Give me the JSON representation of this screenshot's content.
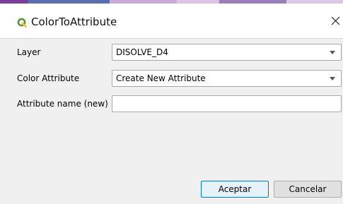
{
  "window": {
    "title": "ColorToAttribute",
    "accent_color": "#589632",
    "stripe_colors": [
      "#7b3f9a",
      "#5a6fb2",
      "#c9a9d8",
      "#dcc4e6",
      "#9a7fb8",
      "#d8c8e4"
    ]
  },
  "form": {
    "layer": {
      "label": "Layer",
      "value": "DISOLVE_D4"
    },
    "color_attribute": {
      "label": "Color Attribute",
      "value": "Create New Attribute"
    },
    "attribute_name": {
      "label": "Attribute name (new)",
      "value": "",
      "placeholder": ""
    }
  },
  "buttons": {
    "ok_label": "Aceptar",
    "cancel_label": "Cancelar"
  },
  "icons": {
    "app": "qgis-logo-icon",
    "close": "close-icon",
    "dropdown": "chevron-down-icon"
  }
}
